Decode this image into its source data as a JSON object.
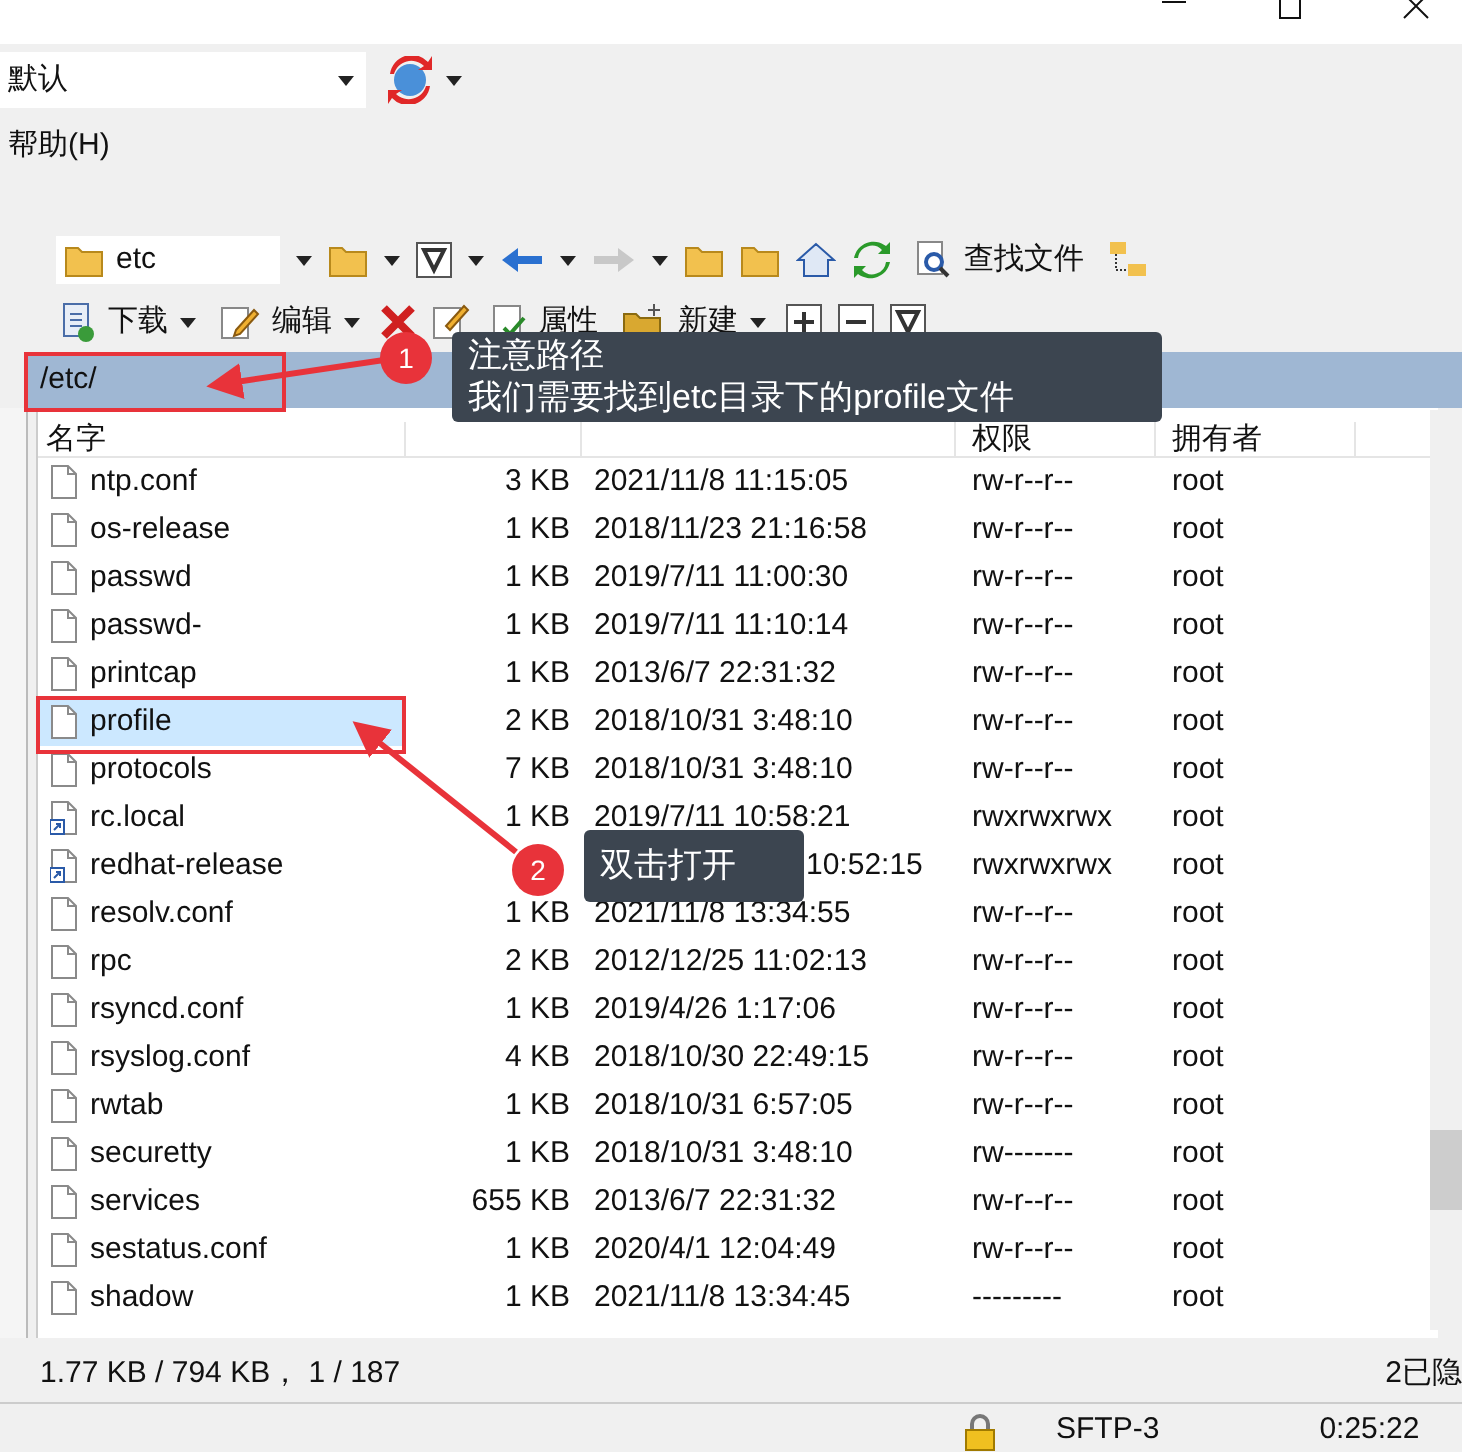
{
  "session": {
    "value": "默认"
  },
  "menu": [
    {
      "label": "帮助(H)"
    }
  ],
  "folder_combo": {
    "value": "etc"
  },
  "find_button": {
    "label": "查找文件"
  },
  "actions": [
    {
      "kind": "download",
      "label": "下载",
      "caret": true
    },
    {
      "kind": "edit",
      "label": "编辑",
      "caret": true
    },
    {
      "kind": "delete"
    },
    {
      "kind": "rename"
    },
    {
      "kind": "properties",
      "label": "属性"
    },
    {
      "kind": "new",
      "label": "新建",
      "caret": true
    },
    {
      "kind": "plus"
    },
    {
      "kind": "minus"
    },
    {
      "kind": "filter"
    }
  ],
  "path": "/etc/",
  "columns": {
    "name": "名字",
    "permissions": "权限",
    "owner": "拥有者"
  },
  "rows": [
    {
      "name": "ntp.conf",
      "size": "3 KB",
      "date": "2021/11/8 11:15:05",
      "perms": "rw-r--r--",
      "owner": "root",
      "kind": "file",
      "selected": false
    },
    {
      "name": "os-release",
      "size": "1 KB",
      "date": "2018/11/23 21:16:58",
      "perms": "rw-r--r--",
      "owner": "root",
      "kind": "file",
      "selected": false
    },
    {
      "name": "passwd",
      "size": "1 KB",
      "date": "2019/7/11 11:00:30",
      "perms": "rw-r--r--",
      "owner": "root",
      "kind": "file",
      "selected": false
    },
    {
      "name": "passwd-",
      "size": "1 KB",
      "date": "2019/7/11 11:10:14",
      "perms": "rw-r--r--",
      "owner": "root",
      "kind": "file",
      "selected": false
    },
    {
      "name": "printcap",
      "size": "1 KB",
      "date": "2013/6/7 22:31:32",
      "perms": "rw-r--r--",
      "owner": "root",
      "kind": "file",
      "selected": false
    },
    {
      "name": "profile",
      "size": "2 KB",
      "date": "2018/10/31 3:48:10",
      "perms": "rw-r--r--",
      "owner": "root",
      "kind": "file",
      "selected": true
    },
    {
      "name": "protocols",
      "size": "7 KB",
      "date": "2018/10/31 3:48:10",
      "perms": "rw-r--r--",
      "owner": "root",
      "kind": "file",
      "selected": false
    },
    {
      "name": "rc.local",
      "size": "1 KB",
      "date": "2019/7/11 10:58:21",
      "perms": "rwxrwxrwx",
      "owner": "root",
      "kind": "link",
      "selected": false
    },
    {
      "name": "redhat-release",
      "date": "10:52:15",
      "covered": true,
      "perms": "rwxrwxrwx",
      "owner": "root",
      "kind": "link",
      "selected": false
    },
    {
      "name": "resolv.conf",
      "size": "1 KB",
      "date": "2021/11/8 13:34:55",
      "perms": "rw-r--r--",
      "owner": "root",
      "kind": "file",
      "selected": false
    },
    {
      "name": "rpc",
      "size": "2 KB",
      "date": "2012/12/25 11:02:13",
      "perms": "rw-r--r--",
      "owner": "root",
      "kind": "file",
      "selected": false
    },
    {
      "name": "rsyncd.conf",
      "size": "1 KB",
      "date": "2019/4/26 1:17:06",
      "perms": "rw-r--r--",
      "owner": "root",
      "kind": "file",
      "selected": false
    },
    {
      "name": "rsyslog.conf",
      "size": "4 KB",
      "date": "2018/10/30 22:49:15",
      "perms": "rw-r--r--",
      "owner": "root",
      "kind": "file",
      "selected": false
    },
    {
      "name": "rwtab",
      "size": "1 KB",
      "date": "2018/10/31 6:57:05",
      "perms": "rw-r--r--",
      "owner": "root",
      "kind": "file",
      "selected": false
    },
    {
      "name": "securetty",
      "size": "1 KB",
      "date": "2018/10/31 3:48:10",
      "perms": "rw-------",
      "owner": "root",
      "kind": "file",
      "selected": false
    },
    {
      "name": "services",
      "size": "655 KB",
      "date": "2013/6/7 22:31:32",
      "perms": "rw-r--r--",
      "owner": "root",
      "kind": "file",
      "selected": false
    },
    {
      "name": "sestatus.conf",
      "size": "1 KB",
      "date": "2020/4/1 12:04:49",
      "perms": "rw-r--r--",
      "owner": "root",
      "kind": "file",
      "selected": false
    },
    {
      "name": "shadow",
      "size": "1 KB",
      "date": "2021/11/8 13:34:45",
      "perms": "---------",
      "owner": "root",
      "kind": "file",
      "selected": false
    }
  ],
  "status": {
    "selection": "1.77 KB / 794 KB， 1 / 187",
    "hidden": "2已隐"
  },
  "bottom_bar": {
    "protocol": "SFTP-3",
    "time": "0:25:22"
  },
  "annotations": [
    {
      "number": "1",
      "lines": [
        "注意路径",
        "我们需要找到etc目录下的profile文件"
      ]
    },
    {
      "number": "2",
      "lines": [
        "双击打开"
      ]
    }
  ]
}
